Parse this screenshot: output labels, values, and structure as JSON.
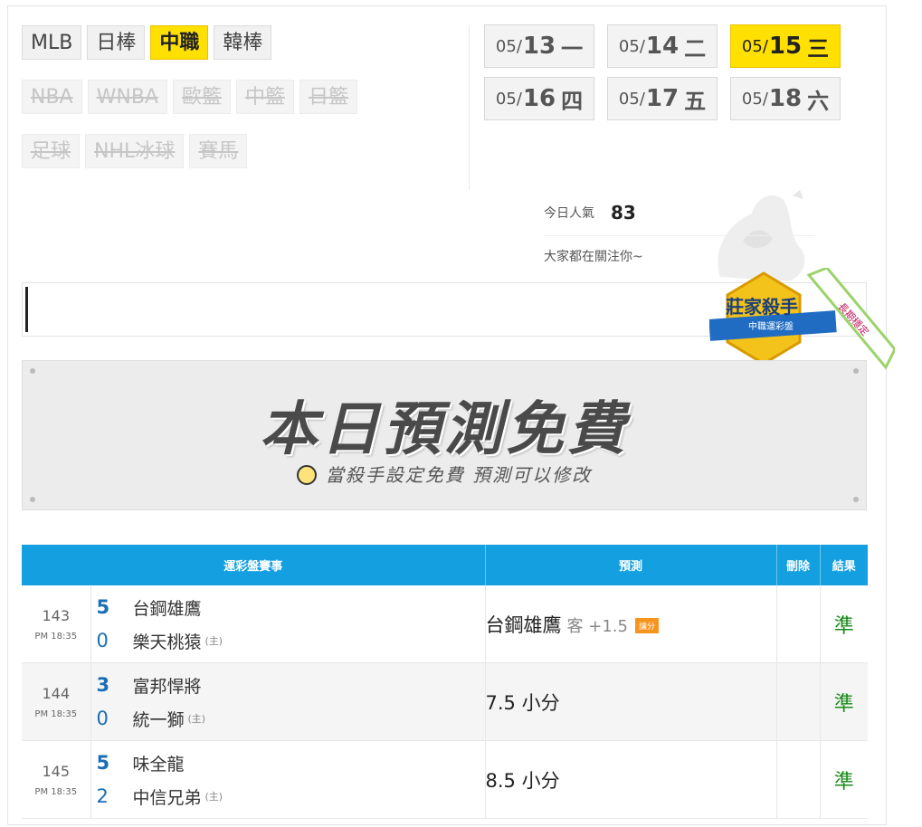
{
  "league_tabs": {
    "row1": [
      {
        "label": "MLB",
        "state": "normal"
      },
      {
        "label": "日棒",
        "state": "normal"
      },
      {
        "label": "中職",
        "state": "active"
      },
      {
        "label": "韓棒",
        "state": "normal"
      }
    ],
    "row2": [
      {
        "label": "NBA",
        "state": "disabled"
      },
      {
        "label": "WNBA",
        "state": "disabled"
      },
      {
        "label": "歐籃",
        "state": "disabled"
      },
      {
        "label": "中籃",
        "state": "disabled"
      },
      {
        "label": "日籃",
        "state": "disabled"
      }
    ],
    "row3": [
      {
        "label": "足球",
        "state": "disabled"
      },
      {
        "label": "NHL冰球",
        "state": "disabled"
      },
      {
        "label": "賽馬",
        "state": "disabled"
      }
    ]
  },
  "dates": [
    {
      "md": "05/",
      "d": "13",
      "w": "一",
      "active": false
    },
    {
      "md": "05/",
      "d": "14",
      "w": "二",
      "active": false
    },
    {
      "md": "05/",
      "d": "15",
      "w": "三",
      "active": true
    },
    {
      "md": "05/",
      "d": "16",
      "w": "四",
      "active": false
    },
    {
      "md": "05/",
      "d": "17",
      "w": "五",
      "active": false
    },
    {
      "md": "05/",
      "d": "18",
      "w": "六",
      "active": false
    }
  ],
  "popularity": {
    "label": "今日人氣",
    "value": "83",
    "message": "大家都在關注你~"
  },
  "badge": {
    "title": "莊家殺手",
    "ribbon": "中職運彩盤",
    "corner": "長期穩定"
  },
  "banner": {
    "title": "本日預測免費",
    "subtitle": "當殺手設定免費  預測可以修改"
  },
  "table": {
    "headers": {
      "event": "運彩盤賽事",
      "prediction": "預測",
      "delete": "刪除",
      "result": "結果"
    },
    "rows": [
      {
        "id": "143",
        "time": "PM 18:35",
        "away_score": "5",
        "away": "台鋼雄鷹",
        "home_score": "0",
        "home": "樂天桃猿",
        "host": "(主)",
        "prediction": "台鋼雄鷹",
        "side": "客 +1.5",
        "tag": "讓分",
        "result": "準"
      },
      {
        "id": "144",
        "time": "PM 18:35",
        "away_score": "3",
        "away": "富邦悍將",
        "home_score": "0",
        "home": "統一獅",
        "host": "(主)",
        "prediction": "7.5 小分",
        "side": "",
        "tag": "",
        "result": "準"
      },
      {
        "id": "145",
        "time": "PM 18:35",
        "away_score": "5",
        "away": "味全龍",
        "home_score": "2",
        "home": "中信兄弟",
        "host": "(主)",
        "prediction": "8.5 小分",
        "side": "",
        "tag": "",
        "result": "準"
      }
    ]
  },
  "colors": {
    "accent": "#ffe000",
    "header_blue": "#14a0e0",
    "score_blue": "#1a6eb5",
    "result_green": "#1a8a1a"
  }
}
